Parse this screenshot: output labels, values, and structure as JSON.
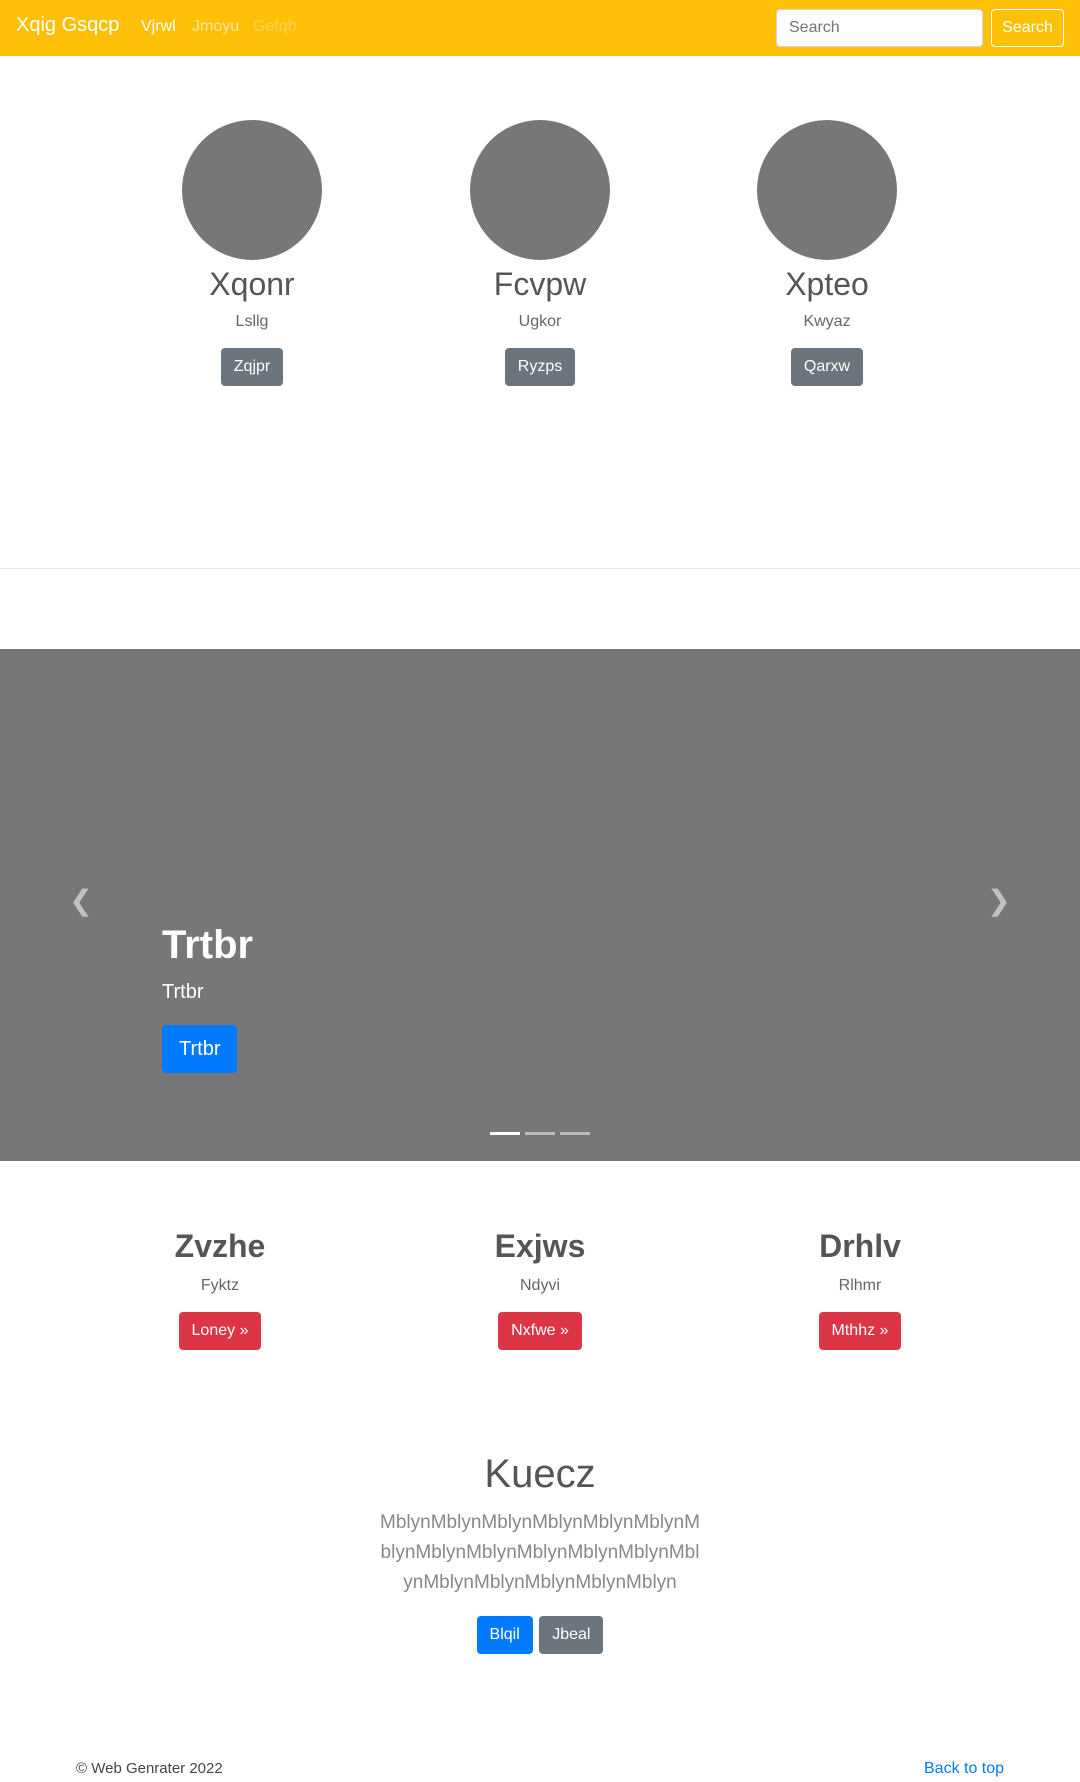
{
  "navbar": {
    "brand": "Xqig Gsqcp",
    "links": [
      "Vjrwl",
      "Jmoyu",
      "Gefqb"
    ],
    "search_placeholder": "Search",
    "search_button": "Search",
    "color": "#ffc107"
  },
  "profiles": [
    {
      "name": "Xqonr",
      "subtitle": "Lsllg",
      "button": "Zqjpr"
    },
    {
      "name": "Fcvpw",
      "subtitle": "Ugkor",
      "button": "Ryzps"
    },
    {
      "name": "Xpteo",
      "subtitle": "Kwyaz",
      "button": "Qarxw"
    }
  ],
  "carousel": {
    "title": "Trtbr",
    "subtitle": "Trtbr",
    "button": "Trtbr",
    "prev_icon": "chevron-left-icon",
    "next_icon": "chevron-right-icon",
    "active_slide": 1,
    "slide_count": 3
  },
  "features": [
    {
      "title": "Zvzhe",
      "subtitle": "Fyktz",
      "button": "Loney »"
    },
    {
      "title": "Exjws",
      "subtitle": "Ndyvi",
      "button": "Nxfwe »"
    },
    {
      "title": "Drhlv",
      "subtitle": "Rlhmr",
      "button": "Mthhz »"
    }
  ],
  "jumbotron": {
    "title": "Kuecz",
    "lead": "MblynMblynMblynMblynMblynMblynMblynMblynMblynMblynMblynMblynMblynMblynMblynMblynMblynMblyn",
    "primary_button": "Blqil",
    "secondary_button": "Jbeal"
  },
  "footer": {
    "copyright": "© Web Genrater 2022",
    "back_to_top": "Back to top"
  }
}
